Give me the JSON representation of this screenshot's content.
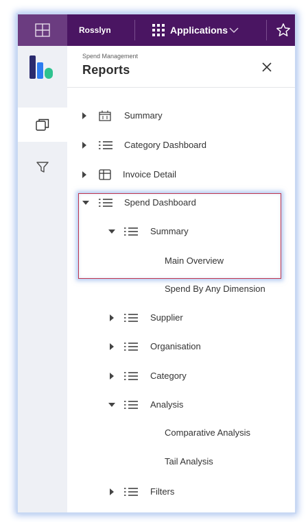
{
  "topbar": {
    "workspace": "Rosslyn",
    "apps_label": "Applications",
    "icons": {
      "grid": "grid-icon",
      "apps": "apps-grid-icon",
      "chevron": "chevron-down-icon",
      "star": "star-icon"
    }
  },
  "sidebar": {
    "icons": {
      "logo": "brand-logo-icon",
      "reports": "reports-nav-icon",
      "filter": "filter-icon"
    }
  },
  "panel": {
    "subtitle": "Spend Management",
    "title": "Reports",
    "close_icon": "close-icon"
  },
  "tree": [
    {
      "label": "Summary",
      "icon": "calendar-icon",
      "expander": "collapsed"
    },
    {
      "label": "Category Dashboard",
      "icon": "list-icon",
      "expander": "collapsed"
    },
    {
      "label": "Invoice Detail",
      "icon": "table-icon",
      "expander": "collapsed"
    },
    {
      "label": "Spend Dashboard",
      "icon": "list-icon",
      "expander": "expanded"
    },
    {
      "label": "Summary",
      "icon": "list-icon",
      "expander": "expanded"
    },
    {
      "label": "Main Overview",
      "icon": "",
      "expander": "none"
    },
    {
      "label": "Spend By Any Dimension",
      "icon": "",
      "expander": "none"
    },
    {
      "label": "Supplier",
      "icon": "list-icon",
      "expander": "collapsed"
    },
    {
      "label": "Organisation",
      "icon": "list-icon",
      "expander": "collapsed"
    },
    {
      "label": "Category",
      "icon": "list-icon",
      "expander": "collapsed"
    },
    {
      "label": "Analysis",
      "icon": "list-icon",
      "expander": "expanded"
    },
    {
      "label": "Comparative Analysis",
      "icon": "",
      "expander": "none"
    },
    {
      "label": "Tail Analysis",
      "icon": "",
      "expander": "none"
    },
    {
      "label": "Filters",
      "icon": "list-icon",
      "expander": "collapsed"
    }
  ],
  "colors": {
    "topbar": "#4a1562",
    "topbar_cell": "#6b3c80",
    "highlight_border": "#c0334a",
    "logo_dark": "#2a2a6e",
    "logo_blue": "#2d7cf0",
    "logo_green": "#2ec28f"
  }
}
